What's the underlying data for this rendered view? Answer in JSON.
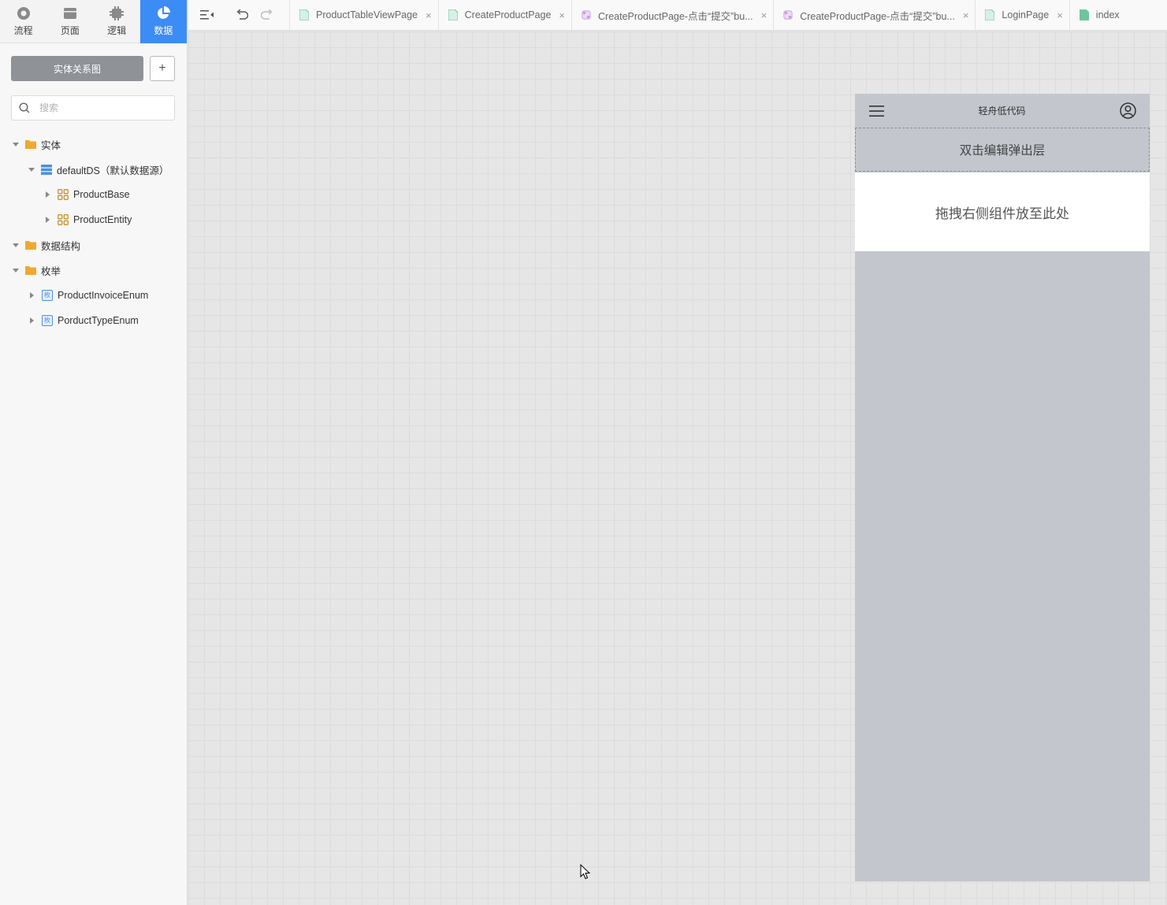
{
  "nav": {
    "tabs": [
      {
        "label": "流程",
        "icon": "flow-icon"
      },
      {
        "label": "页面",
        "icon": "page-icon"
      },
      {
        "label": "逻辑",
        "icon": "logic-icon"
      },
      {
        "label": "数据",
        "icon": "data-icon",
        "active": true
      }
    ]
  },
  "sidebar": {
    "er_button_label": "实体关系图",
    "add_button_label": "+",
    "search_placeholder": "搜索",
    "tree": {
      "entity_folder": "实体",
      "datasource": "defaultDS（默认数据源）",
      "entities": [
        "ProductBase",
        "ProductEntity"
      ],
      "struct_folder": "数据结构",
      "enum_folder": "枚举",
      "enums": [
        "ProductInvoiceEnum",
        "PorductTypeEnum"
      ],
      "enum_badge": "枚"
    }
  },
  "tabs": [
    {
      "label": "ProductTableViewPage",
      "type": "page"
    },
    {
      "label": "CreateProductPage",
      "type": "page"
    },
    {
      "label": "CreateProductPage-点击“提交”bu...",
      "type": "logic"
    },
    {
      "label": "CreateProductPage-点击“提交”bu...",
      "type": "logic"
    },
    {
      "label": "LoginPage",
      "type": "page"
    },
    {
      "label": "index",
      "type": "page"
    }
  ],
  "close_glyph": "×",
  "phone": {
    "title": "轻舟低代码",
    "popup_text": "双击编辑弹出层",
    "drop_text": "拖拽右侧组件放至此处"
  },
  "colors": {
    "accent": "#3c8cf5",
    "folder": "#f0a830",
    "page_tab_icon": "#6fc4a0",
    "logic_tab_icon": "#c79ae0",
    "phone_bg": "#c3c7cd"
  }
}
